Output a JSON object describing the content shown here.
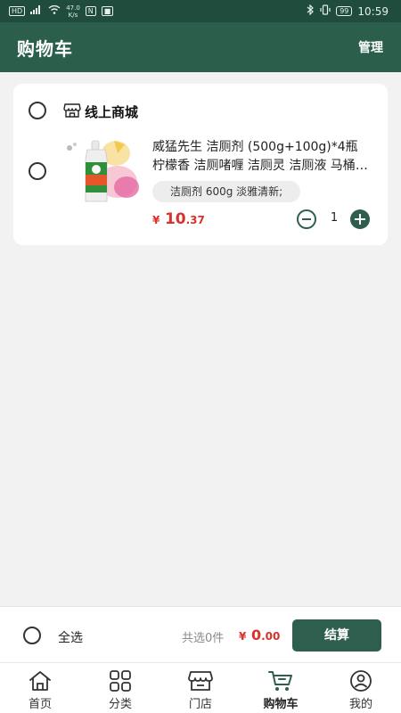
{
  "status_bar": {
    "speed_top": "47.0",
    "speed_bottom": "K/s",
    "battery": "99",
    "time": "10:59"
  },
  "header": {
    "title": "购物车",
    "manage_label": "管理"
  },
  "cart": {
    "store": {
      "icon": "store-icon",
      "name": "线上商城"
    },
    "items": [
      {
        "title": "威猛先生 洁厕剂 (500g+100g)*4瓶 柠檬香 洁厕啫喱 洁厕灵 洁厕液 马桶清洁剂",
        "spec": "洁厕剂 600g 淡雅清新;",
        "price_currency": "¥",
        "price_int": "10",
        "price_dec": ".37",
        "quantity": "1"
      }
    ]
  },
  "footer": {
    "select_all_label": "全选",
    "total_count_label": "共选0件",
    "total_currency": "¥",
    "total_int": "0",
    "total_dec": ".00",
    "checkout_label": "结算"
  },
  "tabs": [
    {
      "label": "首页",
      "icon": "home-icon"
    },
    {
      "label": "分类",
      "icon": "category-grid-icon"
    },
    {
      "label": "门店",
      "icon": "store-icon"
    },
    {
      "label": "购物车",
      "icon": "cart-icon",
      "active": true
    },
    {
      "label": "我的",
      "icon": "profile-icon"
    }
  ],
  "colors": {
    "brand": "#2b5f4c",
    "price_red": "#d9312b"
  }
}
